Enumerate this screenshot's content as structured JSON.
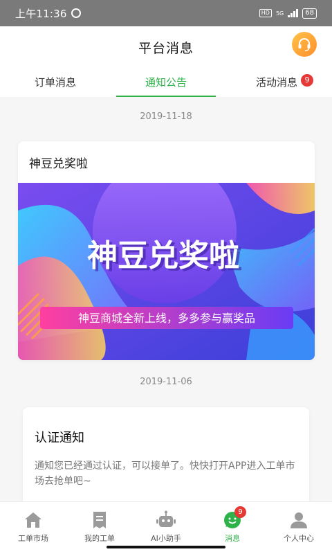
{
  "status_bar": {
    "time": "上午11:36",
    "hd": "HD",
    "network": "5G",
    "battery": "68"
  },
  "header": {
    "title": "平台消息"
  },
  "tabs": [
    {
      "label": "订单消息",
      "active": false
    },
    {
      "label": "通知公告",
      "active": true
    },
    {
      "label": "活动消息",
      "active": false,
      "badge": "9"
    }
  ],
  "notices": [
    {
      "date": "2019-11-18",
      "title": "神豆兑奖啦",
      "banner": {
        "headline": "神豆兑奖啦",
        "subline": "神豆商城全新上线，多多参与赢奖品"
      }
    },
    {
      "date": "2019-11-06",
      "title": "认证通知",
      "body": "通知您已经通过认证，可以接单了。快快打开APP进入工单市场去抢单吧~"
    }
  ],
  "bottom_nav": [
    {
      "label": "工单市场",
      "icon": "home-icon"
    },
    {
      "label": "我的工单",
      "icon": "receipt-icon"
    },
    {
      "label": "AI小助手",
      "icon": "robot-icon"
    },
    {
      "label": "消息",
      "icon": "chat-smile-icon",
      "active": true,
      "badge": "9"
    },
    {
      "label": "个人中心",
      "icon": "person-icon"
    }
  ],
  "colors": {
    "accent": "#2fb24a",
    "badge": "#e53935",
    "support_gradient_start": "#ffc24a",
    "support_gradient_end": "#ff8f2b"
  }
}
